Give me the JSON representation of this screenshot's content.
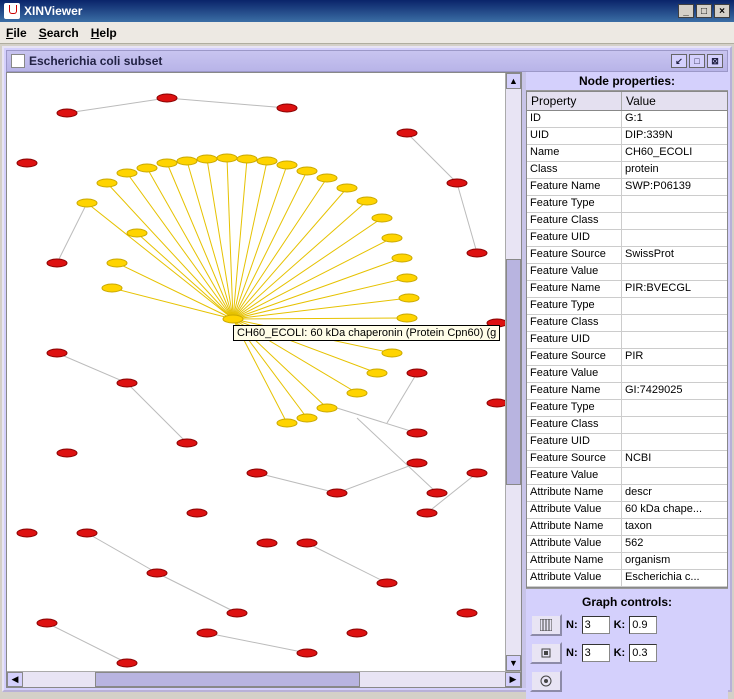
{
  "titlebar": {
    "title": "XINViewer"
  },
  "menubar": {
    "file": "File",
    "search": "Search",
    "help": "Help"
  },
  "inner": {
    "title": "Escherichia coli subset"
  },
  "tooltip": "CH60_ECOLI: 60 kDa chaperonin (Protein Cpn60) (g",
  "props": {
    "title": "Node properties:",
    "col1": "Property",
    "col2": "Value",
    "rows": [
      {
        "p": "ID",
        "v": "G:1"
      },
      {
        "p": "UID",
        "v": "DIP:339N"
      },
      {
        "p": "Name",
        "v": "CH60_ECOLI"
      },
      {
        "p": "Class",
        "v": "protein"
      },
      {
        "p": "Feature Name",
        "v": "SWP:P06139"
      },
      {
        "p": "Feature Type",
        "v": ""
      },
      {
        "p": "Feature Class",
        "v": ""
      },
      {
        "p": "Feature UID",
        "v": ""
      },
      {
        "p": "Feature Source",
        "v": "SwissProt"
      },
      {
        "p": "Feature Value",
        "v": ""
      },
      {
        "p": "Feature Name",
        "v": "PIR:BVECGL"
      },
      {
        "p": "Feature Type",
        "v": ""
      },
      {
        "p": "Feature Class",
        "v": ""
      },
      {
        "p": "Feature UID",
        "v": ""
      },
      {
        "p": "Feature Source",
        "v": "PIR"
      },
      {
        "p": "Feature Value",
        "v": ""
      },
      {
        "p": "Feature Name",
        "v": "GI:7429025"
      },
      {
        "p": "Feature Type",
        "v": ""
      },
      {
        "p": "Feature Class",
        "v": ""
      },
      {
        "p": "Feature UID",
        "v": ""
      },
      {
        "p": "Feature Source",
        "v": "NCBI"
      },
      {
        "p": "Feature Value",
        "v": ""
      },
      {
        "p": "Attribute Name",
        "v": "descr"
      },
      {
        "p": "Attribute Value",
        "v": "60 kDa chape..."
      },
      {
        "p": "Attribute Name",
        "v": "taxon"
      },
      {
        "p": "Attribute Value",
        "v": "562"
      },
      {
        "p": "Attribute Name",
        "v": "organism"
      },
      {
        "p": "Attribute Value",
        "v": "Escherichia c..."
      }
    ]
  },
  "controls": {
    "title": "Graph controls:",
    "n_label": "N:",
    "k_label": "K:",
    "row1_n": "3",
    "row1_k": "0.9",
    "row2_n": "3",
    "row2_k": "0.3"
  }
}
